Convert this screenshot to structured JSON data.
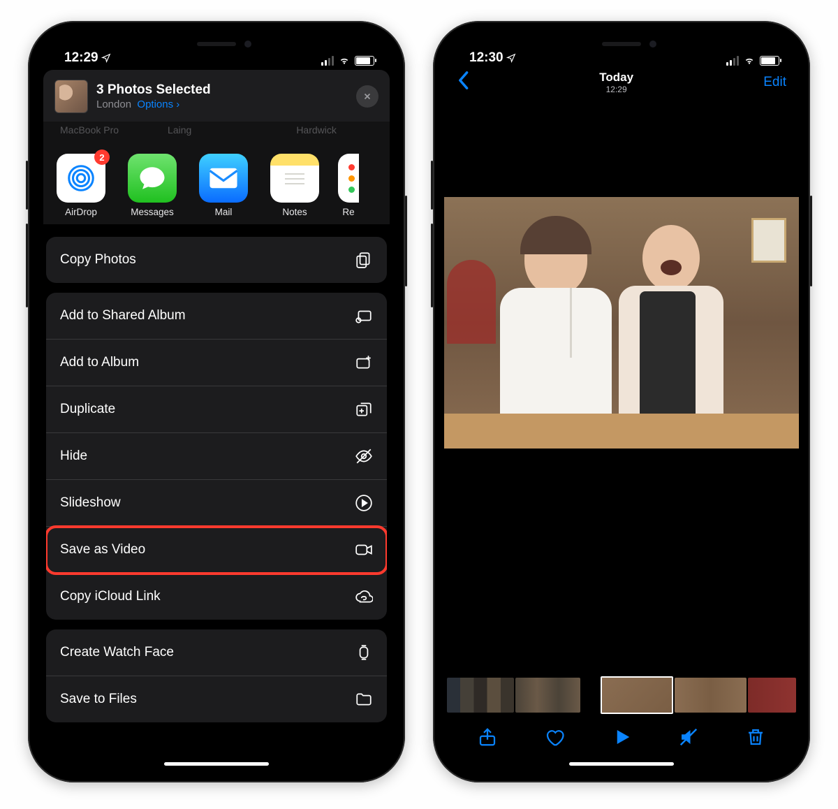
{
  "left": {
    "status_time": "12:29",
    "share": {
      "title": "3 Photos Selected",
      "subtitle_location": "London",
      "options_label": "Options",
      "airdrop_row_names": [
        "MacBook Pro",
        "Laing",
        "Hardwick"
      ],
      "apps": [
        {
          "label": "AirDrop",
          "badge": "2"
        },
        {
          "label": "Messages"
        },
        {
          "label": "Mail"
        },
        {
          "label": "Notes"
        },
        {
          "label": "Re"
        }
      ],
      "actions_group1": [
        {
          "label": "Copy Photos",
          "icon": "copy"
        }
      ],
      "actions_group2": [
        {
          "label": "Add to Shared Album",
          "icon": "shared-album"
        },
        {
          "label": "Add to Album",
          "icon": "album-add"
        },
        {
          "label": "Duplicate",
          "icon": "duplicate"
        },
        {
          "label": "Hide",
          "icon": "hide"
        },
        {
          "label": "Slideshow",
          "icon": "play-circle"
        },
        {
          "label": "Save as Video",
          "icon": "video",
          "highlighted": true
        },
        {
          "label": "Copy iCloud Link",
          "icon": "cloud-link"
        }
      ],
      "actions_group3": [
        {
          "label": "Create Watch Face",
          "icon": "watch"
        },
        {
          "label": "Save to Files",
          "icon": "folder"
        }
      ]
    }
  },
  "right": {
    "status_time": "12:30",
    "nav": {
      "title": "Today",
      "subtitle": "12:29",
      "edit": "Edit"
    }
  }
}
